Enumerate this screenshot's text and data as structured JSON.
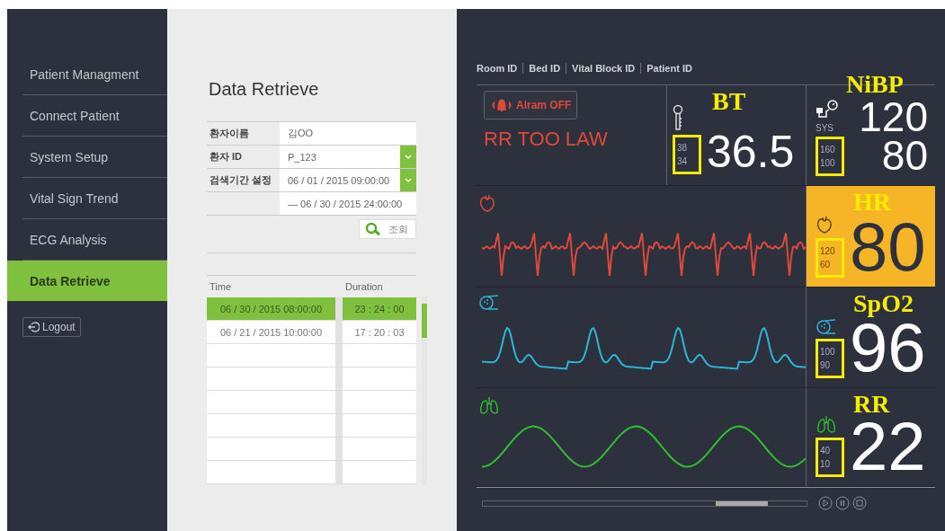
{
  "sidebar": {
    "items": [
      {
        "label": "Patient Managment",
        "selected": false
      },
      {
        "label": "Connect Patient",
        "selected": false
      },
      {
        "label": "System Setup",
        "selected": false
      },
      {
        "label": "Vital Sign Trend",
        "selected": false
      },
      {
        "label": "ECG Analysis",
        "selected": false
      },
      {
        "label": "Data Retrieve",
        "selected": true
      }
    ],
    "logout": "Logout"
  },
  "retrieve": {
    "title": "Data Retrieve",
    "fields": [
      {
        "label": "환자이름",
        "value": "김OO",
        "kind": "text"
      },
      {
        "label": "환자 ID",
        "value": "P_123",
        "kind": "dropdown"
      },
      {
        "label": "검색기간 설정",
        "value": "06 / 01 / 2015  09:00:00",
        "kind": "dropdown"
      }
    ],
    "period_end": "— 06 / 30 / 2015  24:00:00",
    "search_button": "조회",
    "table": {
      "columns": [
        "Time",
        "Duration"
      ],
      "rows": [
        {
          "cells": [
            "06 / 30 / 2015  08:00:00",
            "23 : 24 : 00"
          ],
          "selected": true
        },
        {
          "cells": [
            "06 / 21 / 2015  10:00:00",
            "17 : 20 : 03"
          ],
          "selected": false
        }
      ]
    }
  },
  "monitor": {
    "ids": [
      "Room ID",
      "Bed ID",
      "Vital Block ID",
      "Patient ID"
    ],
    "alarm_button": "Alram OFF",
    "alarm_message": "RR TOO LAW",
    "bt": {
      "label": "BT",
      "upper": "38",
      "lower": "34",
      "value": "36.5"
    },
    "nibp": {
      "label": "NiBP",
      "sub": "SYS",
      "upper": "160",
      "lower": "100",
      "systolic": "120",
      "diastolic": "80"
    },
    "channels": [
      {
        "kind": "ecg",
        "label": "HR",
        "upper": "120",
        "lower": "60",
        "value": "80",
        "color": "#e0493a",
        "highlighted": true
      },
      {
        "kind": "spo2",
        "label": "SpO2",
        "upper": "100",
        "lower": "90",
        "value": "96",
        "color": "#2bb6d6",
        "highlighted": false
      },
      {
        "kind": "resp",
        "label": "RR",
        "upper": "40",
        "lower": "10",
        "value": "22",
        "color": "#2fbf2f",
        "highlighted": false
      }
    ]
  }
}
